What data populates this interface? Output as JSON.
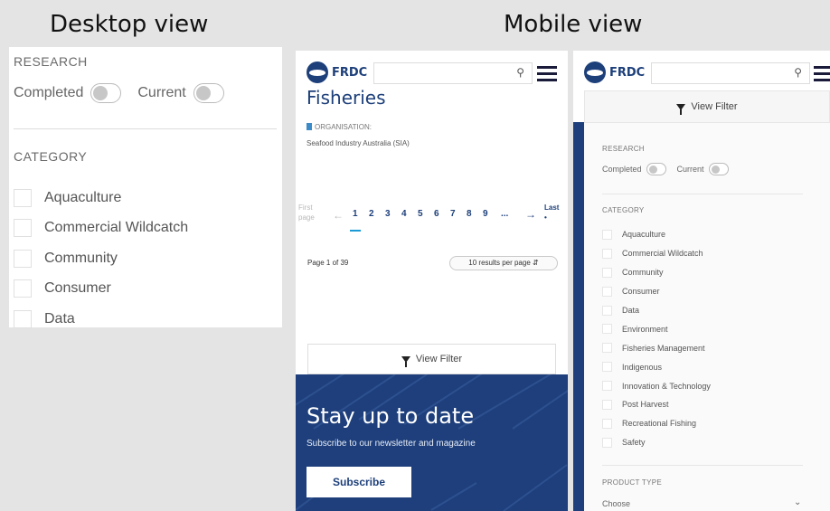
{
  "headings": {
    "desktop": "Desktop view",
    "mobile": "Mobile view"
  },
  "desktop": {
    "research_label": "RESEARCH",
    "completed_label": "Completed",
    "current_label": "Current",
    "category_label": "CATEGORY",
    "categories": [
      "Aquaculture",
      "Commercial Wildcatch",
      "Community",
      "Consumer",
      "Data"
    ]
  },
  "mobile_header": {
    "logo_text": "FRDC",
    "search_placeholder": "",
    "search_icon": "search-icon",
    "menu_icon": "hamburger-icon"
  },
  "mobile_results": {
    "title": "Fisheries",
    "organisation_label": "ORGANISATION:",
    "organisation_value": "Seafood Industry Australia (SIA)",
    "pagination": {
      "first": "First page",
      "last": "Last",
      "pages": [
        "1",
        "2",
        "3",
        "4",
        "5",
        "6",
        "7",
        "8",
        "9",
        "..."
      ],
      "current": 1
    },
    "page_info": "Page 1 of 39",
    "per_page": "10 results per page",
    "view_filter": "View Filter",
    "promo": {
      "title": "Stay up to date",
      "subtitle": "Subscribe to our newsletter and magazine",
      "button": "Subscribe"
    }
  },
  "mobile_filter": {
    "view_filter": "View Filter",
    "research_label": "RESEARCH",
    "completed_label": "Completed",
    "current_label": "Current",
    "category_label": "CATEGORY",
    "categories": [
      "Aquaculture",
      "Commercial Wildcatch",
      "Community",
      "Consumer",
      "Data",
      "Environment",
      "Fisheries Management",
      "Indigenous",
      "Innovation & Technology",
      "Post Harvest",
      "Recreational Fishing",
      "Safety"
    ],
    "product_type_label": "PRODUCT TYPE",
    "product_type_value": "Choose"
  },
  "colors": {
    "brand": "#1d3f7a",
    "accent": "#1b9ad6",
    "background": "#e4e4e4"
  }
}
